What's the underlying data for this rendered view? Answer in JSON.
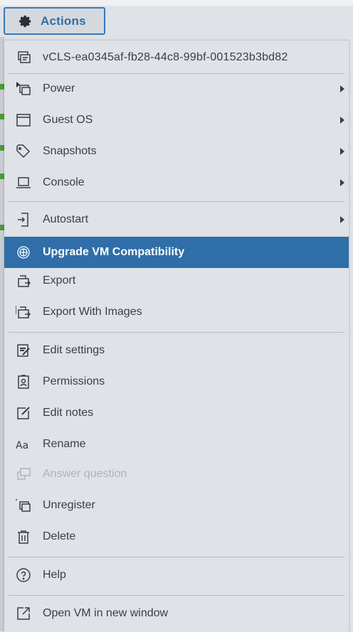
{
  "actions_button": {
    "label": "Actions",
    "icon": "gear-icon"
  },
  "menu": {
    "header": {
      "label": "vCLS-ea0345af-fb28-44c8-99bf-001523b3bd82",
      "icon": "vm-icon"
    },
    "items": [
      {
        "label": "Power",
        "icon": "power-icon",
        "submenu": true
      },
      {
        "label": "Guest OS",
        "icon": "window-icon",
        "submenu": true
      },
      {
        "label": "Snapshots",
        "icon": "tag-icon",
        "submenu": true
      },
      {
        "label": "Console",
        "icon": "laptop-icon",
        "submenu": true
      },
      {
        "label": "Autostart",
        "icon": "autostart-icon",
        "submenu": true
      },
      {
        "label": "Upgrade VM Compatibility",
        "icon": "upgrade-icon",
        "selected": true
      },
      {
        "label": "Export",
        "icon": "export-icon"
      },
      {
        "label": "Export With Images",
        "icon": "export-images-icon"
      },
      {
        "label": "Edit settings",
        "icon": "edit-settings-icon"
      },
      {
        "label": "Permissions",
        "icon": "permissions-icon"
      },
      {
        "label": "Edit notes",
        "icon": "edit-notes-icon"
      },
      {
        "label": "Rename",
        "icon": "rename-icon"
      },
      {
        "label": "Answer question",
        "icon": "answer-question-icon",
        "disabled": true
      },
      {
        "label": "Unregister",
        "icon": "unregister-icon"
      },
      {
        "label": "Delete",
        "icon": "trash-icon"
      },
      {
        "label": "Help",
        "icon": "help-icon"
      },
      {
        "label": "Open VM in new window",
        "icon": "open-external-icon"
      }
    ]
  },
  "colors": {
    "accent": "#2f6ea8",
    "menu_bg": "#dfe2e6",
    "text": "#3b3f44",
    "disabled": "#b0b4b9"
  }
}
